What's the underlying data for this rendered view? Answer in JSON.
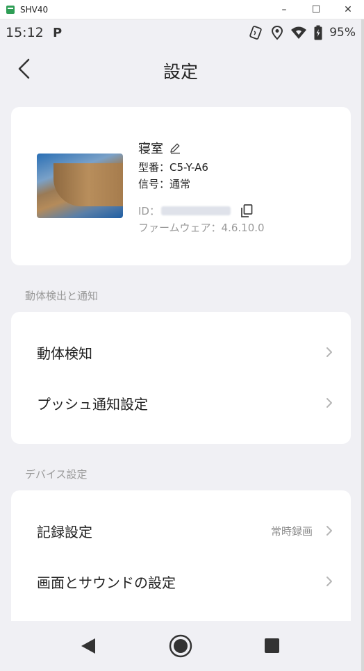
{
  "window": {
    "title": "SHV40",
    "minimize": "–",
    "maximize": "☐",
    "close": "✕"
  },
  "statusbar": {
    "time": "15:12",
    "notif_icon": "P",
    "battery_pct": "95%"
  },
  "header": {
    "title": "設定"
  },
  "device": {
    "name": "寝室",
    "model": "型番：C5-Y-A6",
    "signal": "信号：通常",
    "id_label": "ID：",
    "firmware": "ファームウェア：4.6.10.0"
  },
  "sections": {
    "motion": {
      "label": "動体検出と通知",
      "items": [
        {
          "label": "動体検知"
        },
        {
          "label": "プッシュ通知設定"
        }
      ]
    },
    "device_settings": {
      "label": "デバイス設定",
      "items": [
        {
          "label": "記録設定",
          "value": "常時録画"
        },
        {
          "label": "画面とサウンドの設定"
        }
      ]
    }
  },
  "colors": {
    "background": "#f0f0f4",
    "card": "#ffffff",
    "text_primary": "#222222",
    "text_secondary": "#999999",
    "chevron": "#b5b5b5"
  }
}
